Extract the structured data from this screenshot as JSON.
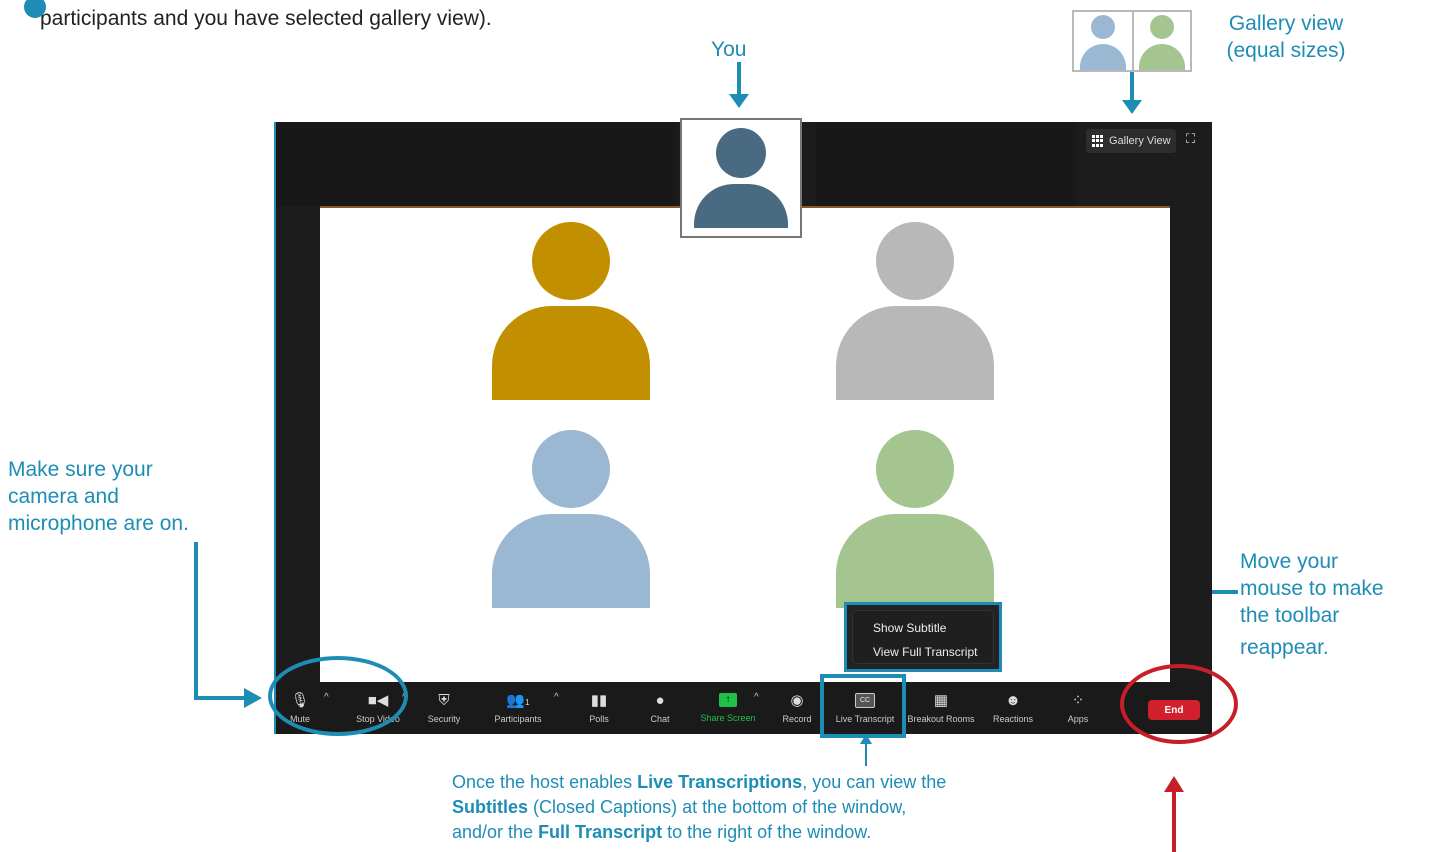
{
  "intro": {
    "text": "participants and you have selected gallery view)."
  },
  "callouts": {
    "you": "You",
    "gallery_line1": "Gallery view",
    "gallery_line2": "(equal sizes)",
    "camera_line1": "Make sure your",
    "camera_line2": "camera and",
    "camera_line3": "microphone are on.",
    "mouse_line1": "Move your",
    "mouse_line2": "mouse to make",
    "mouse_line3": "the toolbar",
    "mouse_line4": "reappear.",
    "bottom_1": "Once the host enables ",
    "bottom_1b": "Live Transcriptions",
    "bottom_1c": ", you can view the",
    "bottom_2a": "Subtitles",
    "bottom_2b": " (Closed Captions) at the bottom of the window,",
    "bottom_3a": "and/or the ",
    "bottom_3b": "Full Transcript",
    "bottom_3c": " to the right of the window."
  },
  "window": {
    "gallery_view_label": "Gallery View",
    "transcript_menu": {
      "items": [
        "Show Subtitle",
        "View Full Transcript"
      ]
    }
  },
  "toolbar": {
    "mute": "Mute",
    "stop_video": "Stop Video",
    "security": "Security",
    "participants": "Participants",
    "participants_count": "1",
    "polls": "Polls",
    "chat": "Chat",
    "share_screen": "Share Screen",
    "record": "Record",
    "live_transcript": "Live Transcript",
    "cc_glyph": "CC",
    "breakout_rooms": "Breakout Rooms",
    "reactions": "Reactions",
    "apps": "Apps",
    "end": "End"
  },
  "colors": {
    "accent": "#1E8DB5",
    "end_red": "#d11f2d",
    "share_green": "#1fc148",
    "self_avatar": "#4a6a82",
    "avatar_gold": "#c28f00",
    "avatar_gray": "#b8b8b8",
    "avatar_blue": "#9bb8d3",
    "avatar_green": "#a5c590"
  }
}
